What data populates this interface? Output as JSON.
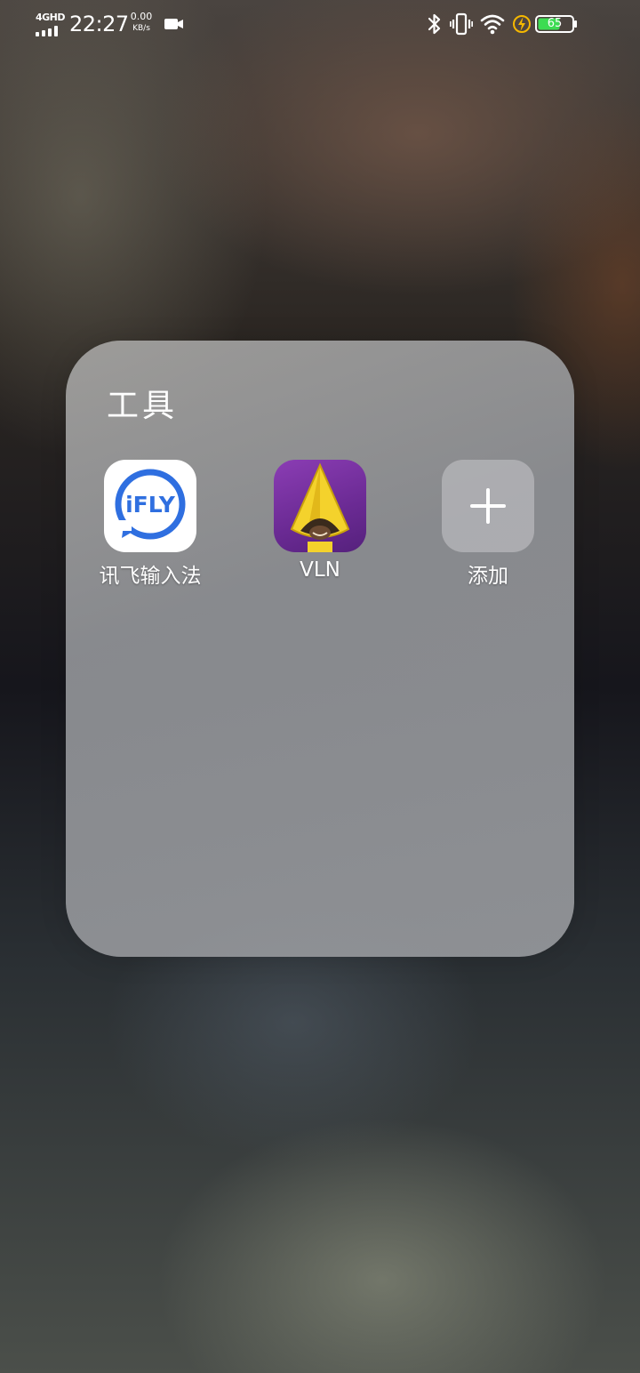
{
  "status_bar": {
    "network_type": "4GHD",
    "time": "22:27",
    "speed_value": "0.00",
    "speed_unit": "KB/s",
    "battery_level": "65",
    "icons": [
      "signal-icon",
      "video-record-icon",
      "bluetooth-icon",
      "vibrate-icon",
      "wifi-icon",
      "charging-icon",
      "battery-icon"
    ]
  },
  "folder": {
    "title": "工具",
    "apps": [
      {
        "label": "讯飞输入法",
        "icon": "ifly-app-icon",
        "icon_text": "iFLY"
      },
      {
        "label": "VLN",
        "icon": "vln-app-icon"
      },
      {
        "label": "添加",
        "icon": "plus-icon"
      }
    ]
  },
  "colors": {
    "battery_fill": "#3ddc52",
    "charging_bolt": "#f5b800",
    "ifly_blue": "#2f6fe0"
  }
}
